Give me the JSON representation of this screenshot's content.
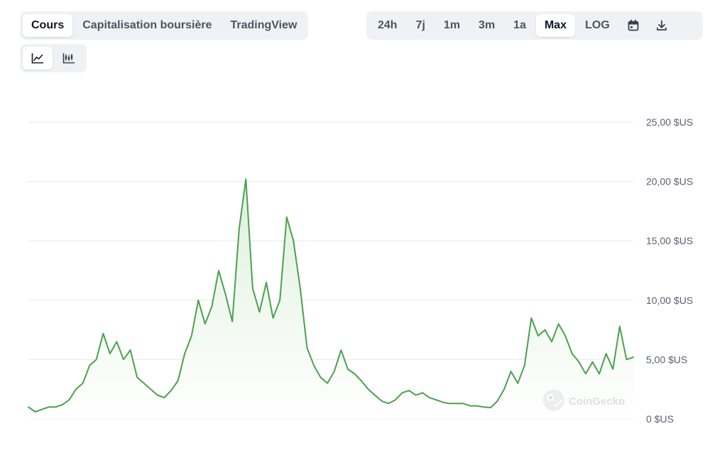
{
  "tabs": [
    {
      "label": "Cours",
      "active": true
    },
    {
      "label": "Capitalisation boursière",
      "active": false
    },
    {
      "label": "TradingView",
      "active": false
    }
  ],
  "ranges": [
    {
      "label": "24h",
      "active": false
    },
    {
      "label": "7j",
      "active": false
    },
    {
      "label": "1m",
      "active": false
    },
    {
      "label": "3m",
      "active": false
    },
    {
      "label": "1a",
      "active": false
    },
    {
      "label": "Max",
      "active": true
    },
    {
      "label": "LOG",
      "active": false
    }
  ],
  "range_icons": [
    "calendar-icon",
    "download-icon"
  ],
  "view_toggle": {
    "items": [
      "line-chart-icon",
      "candlestick-chart-icon"
    ],
    "active": "line-chart-icon"
  },
  "watermark": "CoinGecko",
  "colors": {
    "line": "#4ba14f",
    "fill_top": "#dff0dd",
    "fill_bottom": "#ffffff",
    "grid": "#e5e7eb",
    "axis_text": "#586174"
  },
  "chart_data": {
    "type": "area",
    "ylim": [
      0,
      25
    ],
    "ytick_values": [
      0,
      5,
      10,
      15,
      20,
      25
    ],
    "ytick_labels": [
      "0 $US",
      "5,00 $US",
      "10,00 $US",
      "15,00 $US",
      "20,00 $US",
      "25,00 $US"
    ],
    "y_axis_position": "right",
    "grid": true,
    "series": [
      {
        "values": [
          1.0,
          0.6,
          0.8,
          1.0,
          1.0,
          1.2,
          1.6,
          2.5,
          3.0,
          4.5,
          5.0,
          7.2,
          5.5,
          6.5,
          5.0,
          5.8,
          3.5,
          3.0,
          2.5,
          2.0,
          1.8,
          2.4,
          3.2,
          5.5,
          7.0,
          10.0,
          8.0,
          9.5,
          12.5,
          10.5,
          8.2,
          16.0,
          20.2,
          11.0,
          9.0,
          11.5,
          8.5,
          10.0,
          17.0,
          15.0,
          11.0,
          6.0,
          4.5,
          3.5,
          3.0,
          4.0,
          5.8,
          4.2,
          3.8,
          3.2,
          2.5,
          2.0,
          1.5,
          1.3,
          1.6,
          2.2,
          2.4,
          2.0,
          2.2,
          1.8,
          1.6,
          1.4,
          1.3,
          1.3,
          1.3,
          1.1,
          1.1,
          1.0,
          0.95,
          1.5,
          2.5,
          4.0,
          3.0,
          4.5,
          8.5,
          7.0,
          7.5,
          6.5,
          8.0,
          7.0,
          5.5,
          4.8,
          3.8,
          4.8,
          3.8,
          5.5,
          4.2,
          7.8,
          5.0,
          5.2
        ]
      }
    ]
  }
}
